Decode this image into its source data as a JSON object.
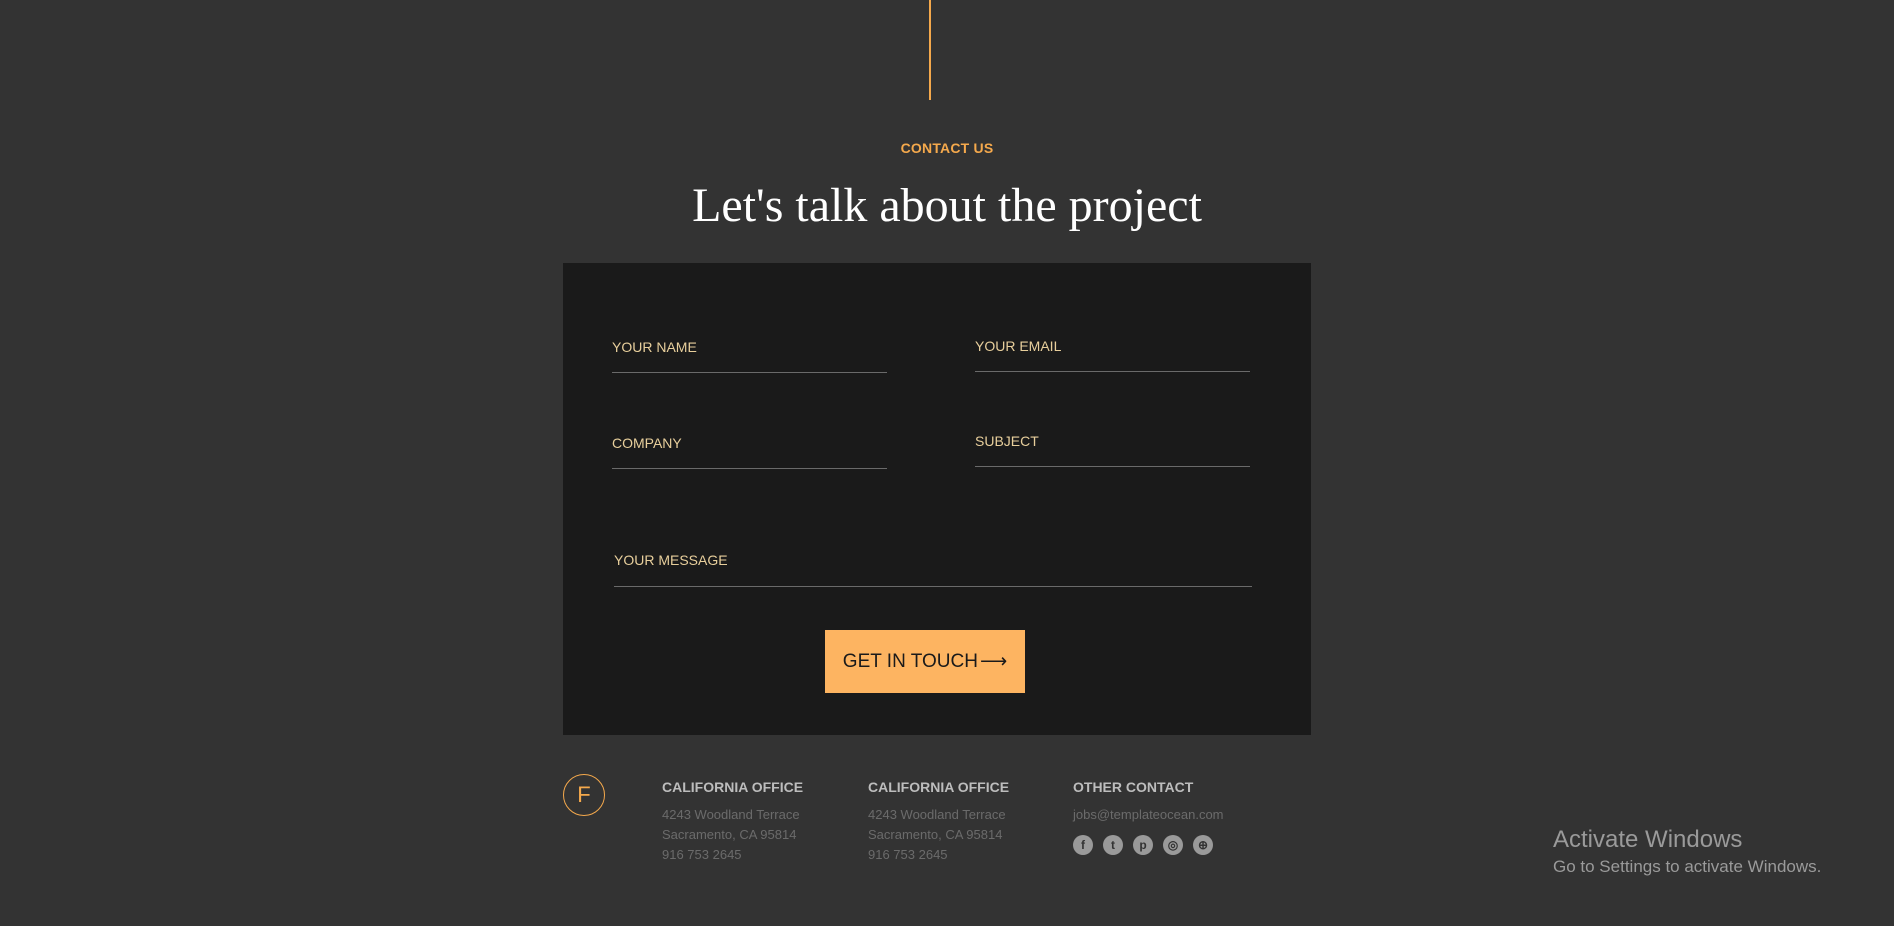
{
  "header": {
    "eyebrow": "CONTACT US",
    "title": "Let's talk about the project"
  },
  "form": {
    "fields": {
      "name": "YOUR NAME",
      "email": "YOUR EMAIL",
      "company": "COMPANY",
      "subject": "SUBJECT",
      "message": "YOUR MESSAGE"
    },
    "submit_label": "GET IN TOUCH",
    "submit_arrow": "⟶"
  },
  "footer": {
    "logo_letter": "F",
    "columns": [
      {
        "heading": "CALIFORNIA OFFICE",
        "lines": [
          "4243 Woodland Terrace",
          "Sacramento, CA 95814",
          "916 753 2645"
        ]
      },
      {
        "heading": "CALIFORNIA OFFICE",
        "lines": [
          "4243 Woodland Terrace",
          "Sacramento, CA 95814",
          "916 753 2645"
        ]
      }
    ],
    "other_contact": {
      "heading": "OTHER CONTACT",
      "email": "jobs@templateocean.com",
      "social": [
        {
          "name": "facebook-icon",
          "glyph": "f"
        },
        {
          "name": "twitter-icon",
          "glyph": "t"
        },
        {
          "name": "pinterest-icon",
          "glyph": "p"
        },
        {
          "name": "instagram-icon",
          "glyph": "◎"
        },
        {
          "name": "dribbble-icon",
          "glyph": "⊕"
        }
      ]
    }
  },
  "system_overlay": {
    "activate_title": "Activate Windows",
    "activate_subtitle": "Go to Settings to activate Windows."
  },
  "colors": {
    "page_background": "#333333",
    "panel_background": "#1a1a1a",
    "accent": "#f5a94c",
    "button": "#fdb461"
  }
}
